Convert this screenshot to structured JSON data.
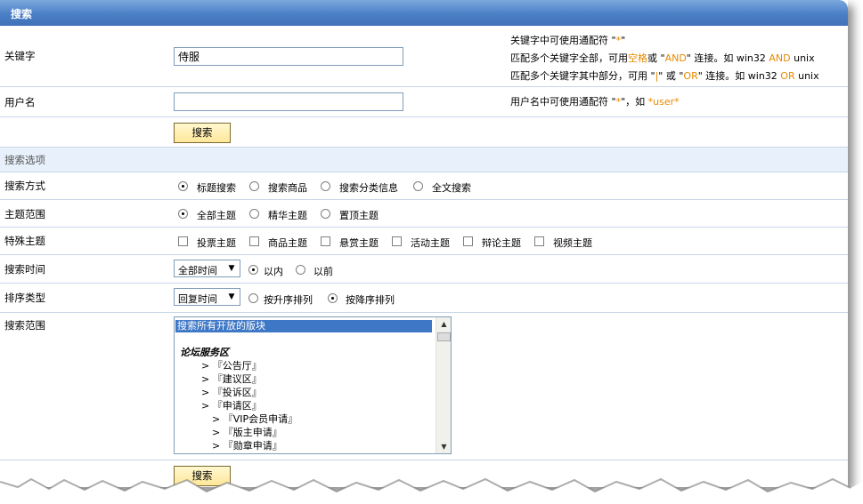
{
  "header": {
    "title": "搜索"
  },
  "keyword": {
    "label": "关键字",
    "value": "侍服",
    "hints": [
      [
        "关键字中可使用通配符 \"",
        "*",
        "\""
      ],
      [
        "匹配多个关键字全部，可用",
        "空格",
        "或 \"",
        "AND",
        "\" 连接。如 win32 ",
        "AND",
        " unix"
      ],
      [
        "匹配多个关键字其中部分，可用 \"",
        "|",
        "\" 或 \"",
        "OR",
        "\" 连接。如 win32 ",
        "OR",
        " unix"
      ]
    ]
  },
  "username": {
    "label": "用户名",
    "value": "",
    "hint_prefix": "用户名中可使用通配符 \"",
    "hint_star": "*",
    "hint_mid": "\"，如 ",
    "hint_example": "*user*"
  },
  "search_button_label": "搜索",
  "options_section": "搜索选项",
  "search_mode": {
    "label": "搜索方式",
    "options": [
      "标题搜索",
      "搜索商品",
      "搜索分类信息",
      "全文搜索"
    ],
    "selected": 0
  },
  "topic_scope": {
    "label": "主题范围",
    "options": [
      "全部主题",
      "精华主题",
      "置顶主题"
    ],
    "selected": 0
  },
  "special_topic": {
    "label": "特殊主题",
    "options": [
      "投票主题",
      "商品主题",
      "悬赏主题",
      "活动主题",
      "辩论主题",
      "视频主题"
    ]
  },
  "search_time": {
    "label": "搜索时间",
    "select_value": "全部时间",
    "options": [
      "以内",
      "以前"
    ],
    "selected": 0
  },
  "sort_type": {
    "label": "排序类型",
    "select_value": "回复时间",
    "options": [
      "按升序排列",
      "按降序排列"
    ],
    "selected": 1
  },
  "search_scope": {
    "label": "搜索范围",
    "items": [
      "搜索所有开放的版块",
      "",
      "论坛服务区",
      "> 『公告厅』",
      "> 『建议区』",
      "> 『投诉区』",
      "> 『申请区』",
      "> 『VIP会员申请』",
      "> 『版主申请』",
      "> 『勋章申请』"
    ]
  }
}
